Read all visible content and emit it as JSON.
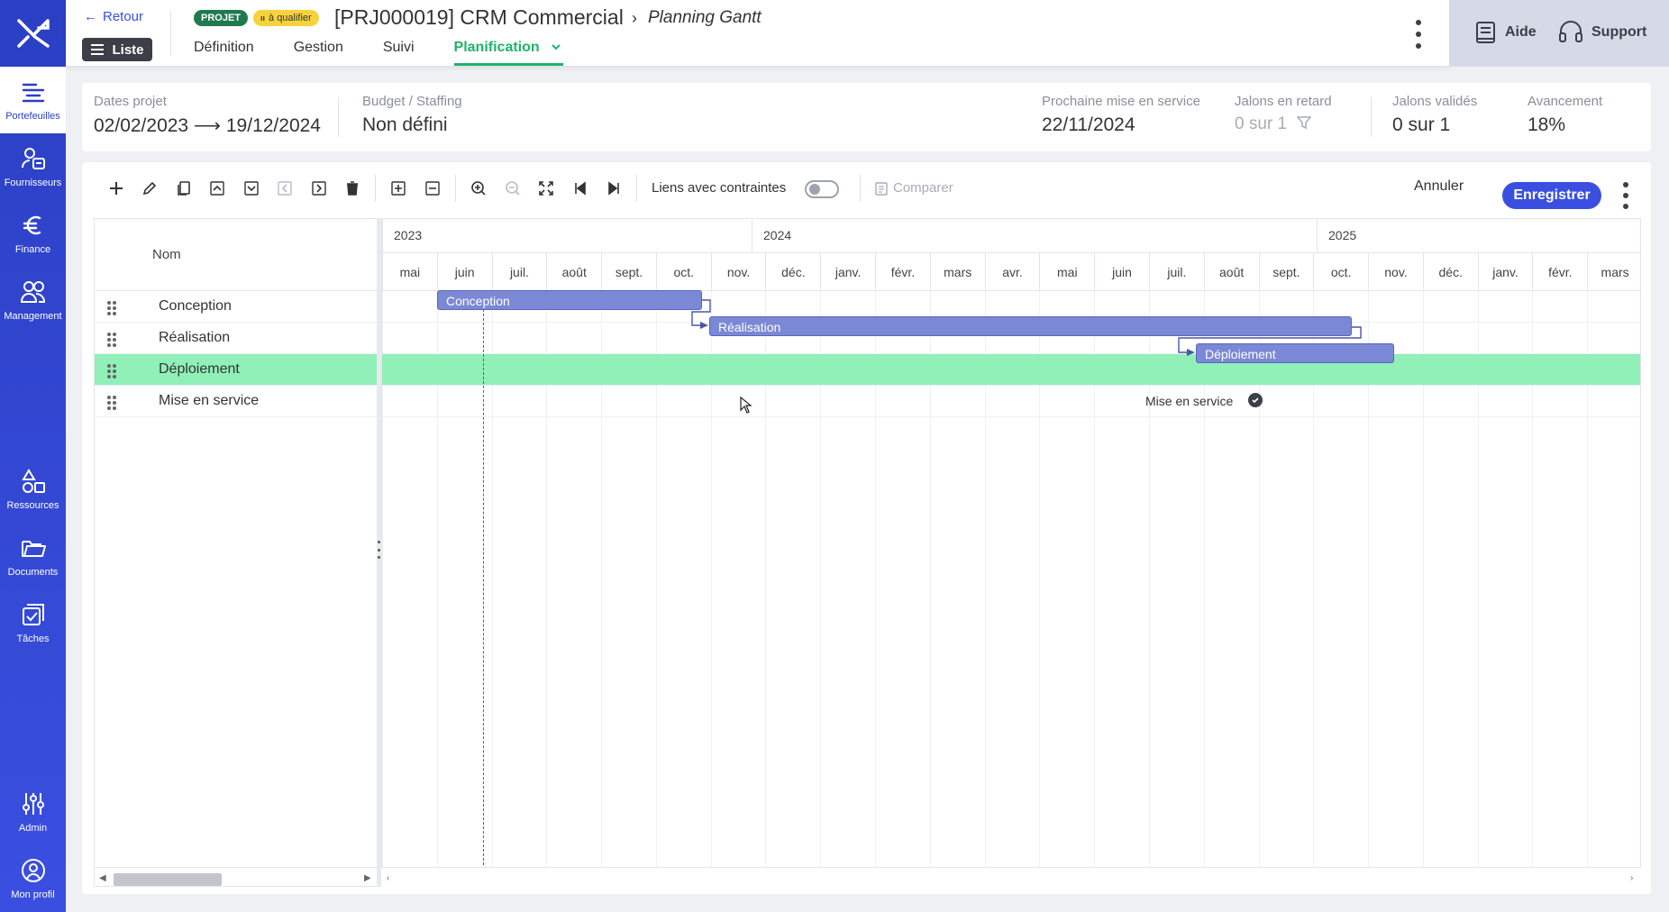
{
  "sidebar": {
    "items": [
      {
        "label": "Portefeuilles",
        "icon": "portfolio-icon"
      },
      {
        "label": "Fournisseurs",
        "icon": "suppliers-icon"
      },
      {
        "label": "Finance",
        "icon": "euro-icon"
      },
      {
        "label": "Management",
        "icon": "people-icon"
      },
      {
        "label": "Ressources",
        "icon": "shapes-icon"
      },
      {
        "label": "Documents",
        "icon": "folder-icon"
      },
      {
        "label": "Tâches",
        "icon": "tasks-icon"
      },
      {
        "label": "Admin",
        "icon": "sliders-icon"
      },
      {
        "label": "Mon profil",
        "icon": "user-circle-icon"
      }
    ]
  },
  "header": {
    "back_label": "Retour",
    "list_label": "Liste",
    "badge_project": "PROJET",
    "badge_status": "à qualifier",
    "title": "[PRJ000019] CRM Commercial",
    "page": "Planning Gantt",
    "tabs": [
      {
        "label": "Définition"
      },
      {
        "label": "Gestion"
      },
      {
        "label": "Suivi"
      },
      {
        "label": "Planification"
      }
    ],
    "help_label": "Aide",
    "support_label": "Support"
  },
  "info": {
    "dates_label": "Dates projet",
    "dates_value": "02/02/2023 ⟶ 19/12/2024",
    "budget_label": "Budget / Staffing",
    "budget_value": "Non défini",
    "next_label": "Prochaine mise en service",
    "next_value": "22/11/2024",
    "late_label": "Jalons en retard",
    "late_value": "0 sur 1",
    "validated_label": "Jalons validés",
    "validated_value": "0 sur 1",
    "progress_label": "Avancement",
    "progress_value": "18%"
  },
  "toolbar": {
    "links_label": "Liens avec contraintes",
    "compare_label": "Comparer",
    "cancel_label": "Annuler",
    "save_label": "Enregistrer"
  },
  "grid": {
    "name_header": "Nom",
    "rows": [
      {
        "name": "Conception"
      },
      {
        "name": "Réalisation"
      },
      {
        "name": "Déploiement"
      },
      {
        "name": "Mise en service"
      }
    ]
  },
  "timeline": {
    "years": [
      "2023",
      "2024",
      "2025"
    ],
    "months": [
      "mai",
      "juin",
      "juil.",
      "août",
      "sept.",
      "oct.",
      "nov.",
      "déc.",
      "janv.",
      "févr.",
      "mars",
      "avr.",
      "mai",
      "juin",
      "juil.",
      "août",
      "sept.",
      "oct.",
      "nov.",
      "déc.",
      "janv.",
      "févr.",
      "mars"
    ],
    "bars": [
      {
        "label": "Conception"
      },
      {
        "label": "Réalisation"
      },
      {
        "label": "Déploiement"
      }
    ],
    "milestone_label": "Mise en service"
  },
  "colors": {
    "accent": "#3a4fe0",
    "active_tab": "#1fb36a",
    "selected_row": "#90f0b8",
    "bar": "#7b88d6"
  }
}
